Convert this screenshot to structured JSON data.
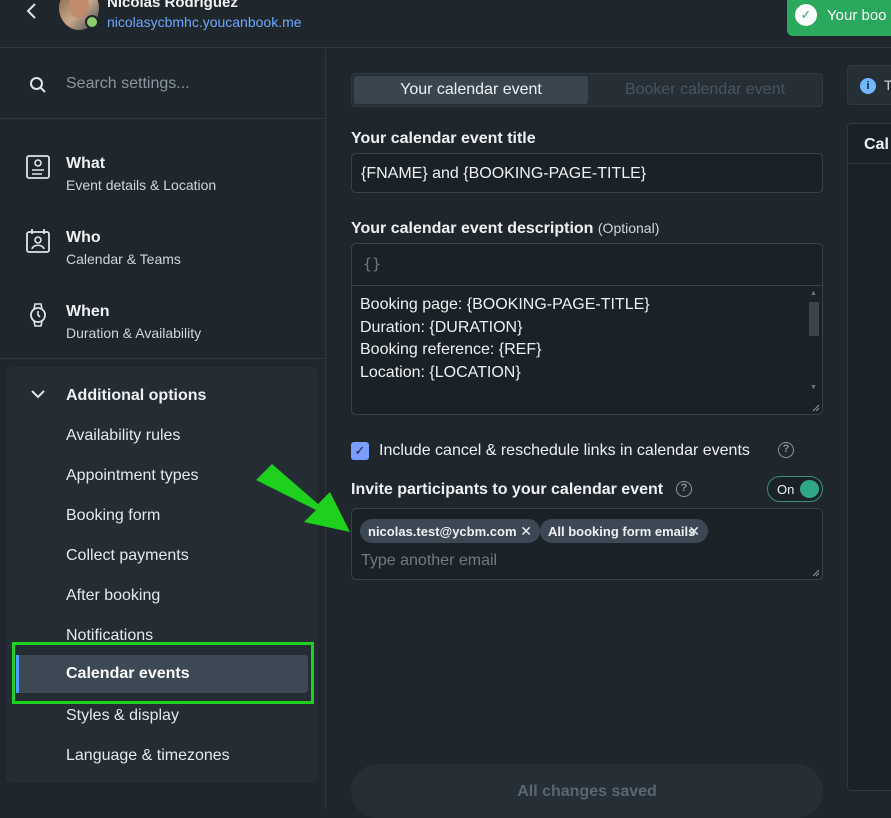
{
  "header": {
    "user_name": "Nicolas Rodriguez",
    "user_url": "nicolasycbmhc.youcanbook.me",
    "toast_text": "Your boo"
  },
  "sidebar": {
    "search_placeholder": "Search settings...",
    "nav": [
      {
        "title": "What",
        "subtitle": "Event details & Location"
      },
      {
        "title": "Who",
        "subtitle": "Calendar & Teams"
      },
      {
        "title": "When",
        "subtitle": "Duration & Availability"
      }
    ],
    "additional_options": {
      "label": "Additional options",
      "items": [
        "Availability rules",
        "Appointment types",
        "Booking form",
        "Collect payments",
        "After booking",
        "Notifications",
        "Calendar events",
        "Styles & display",
        "Language & timezones"
      ],
      "active": "Calendar events"
    }
  },
  "main": {
    "tabs": [
      "Your calendar event",
      "Booker calendar event"
    ],
    "title_label": "Your calendar event title",
    "title_value": "{FNAME} and {BOOKING-PAGE-TITLE}",
    "desc_label": "Your calendar event description",
    "desc_optional": "(Optional)",
    "desc_toolbar_icon": "{}",
    "desc_text": "Booking page: {BOOKING-PAGE-TITLE}\nDuration: {DURATION}\nBooking reference: {REF}\nLocation: {LOCATION}\n\n{FORMFIELDS}",
    "include_links_label": "Include cancel & reschedule links in calendar events",
    "include_links_checked": true,
    "invite_label": "Invite participants to your calendar event",
    "invite_toggle": "On",
    "invite_chips": [
      "nicolas.test@ycbm.com",
      "All booking form emails"
    ],
    "invite_placeholder": "Type another email",
    "save_status": "All changes saved"
  },
  "right_panel": {
    "info_text": "T",
    "preview_title": "Cal"
  },
  "colors": {
    "accent_green": "#2aa85e",
    "annotation_green": "#1fd01f",
    "toggle_on": "#2fa88a",
    "link_blue": "#6ea8ff"
  }
}
